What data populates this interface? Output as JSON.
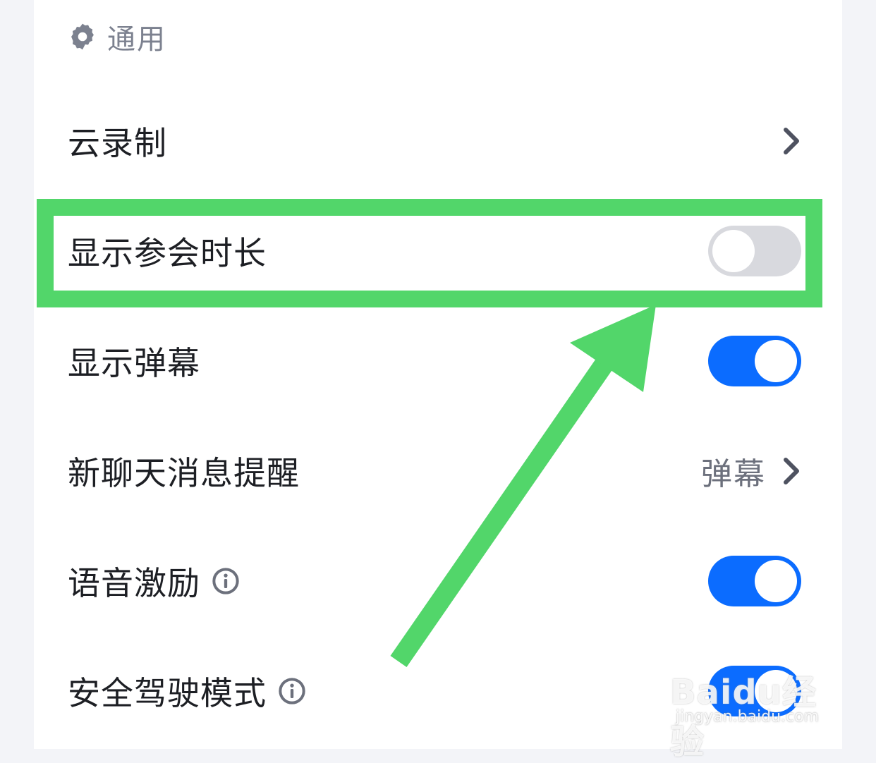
{
  "section": {
    "title": "通用",
    "icon": "gear-icon"
  },
  "rows": [
    {
      "label": "云录制",
      "control": "chevron"
    },
    {
      "label": "显示参会时长",
      "control": "toggle",
      "state": "off"
    },
    {
      "label": "显示弹幕",
      "control": "toggle",
      "state": "on"
    },
    {
      "label": "新聊天消息提醒",
      "control": "value-chevron",
      "value": "弹幕"
    },
    {
      "label": "语音激励",
      "control": "toggle",
      "state": "on",
      "info": true
    },
    {
      "label": "安全驾驶模式",
      "control": "toggle",
      "state": "on",
      "info": true
    }
  ],
  "annotation": {
    "highlight_color": "#52d66a",
    "highlighted_row": "显示参会时长"
  },
  "colors": {
    "toggle_on": "#0b6cff",
    "toggle_off": "#d8d9de",
    "text": "#1d1f24",
    "secondary": "#7c818f"
  },
  "watermark": {
    "brand": "Baidu经验",
    "url": "jingyan.baidu.com"
  }
}
